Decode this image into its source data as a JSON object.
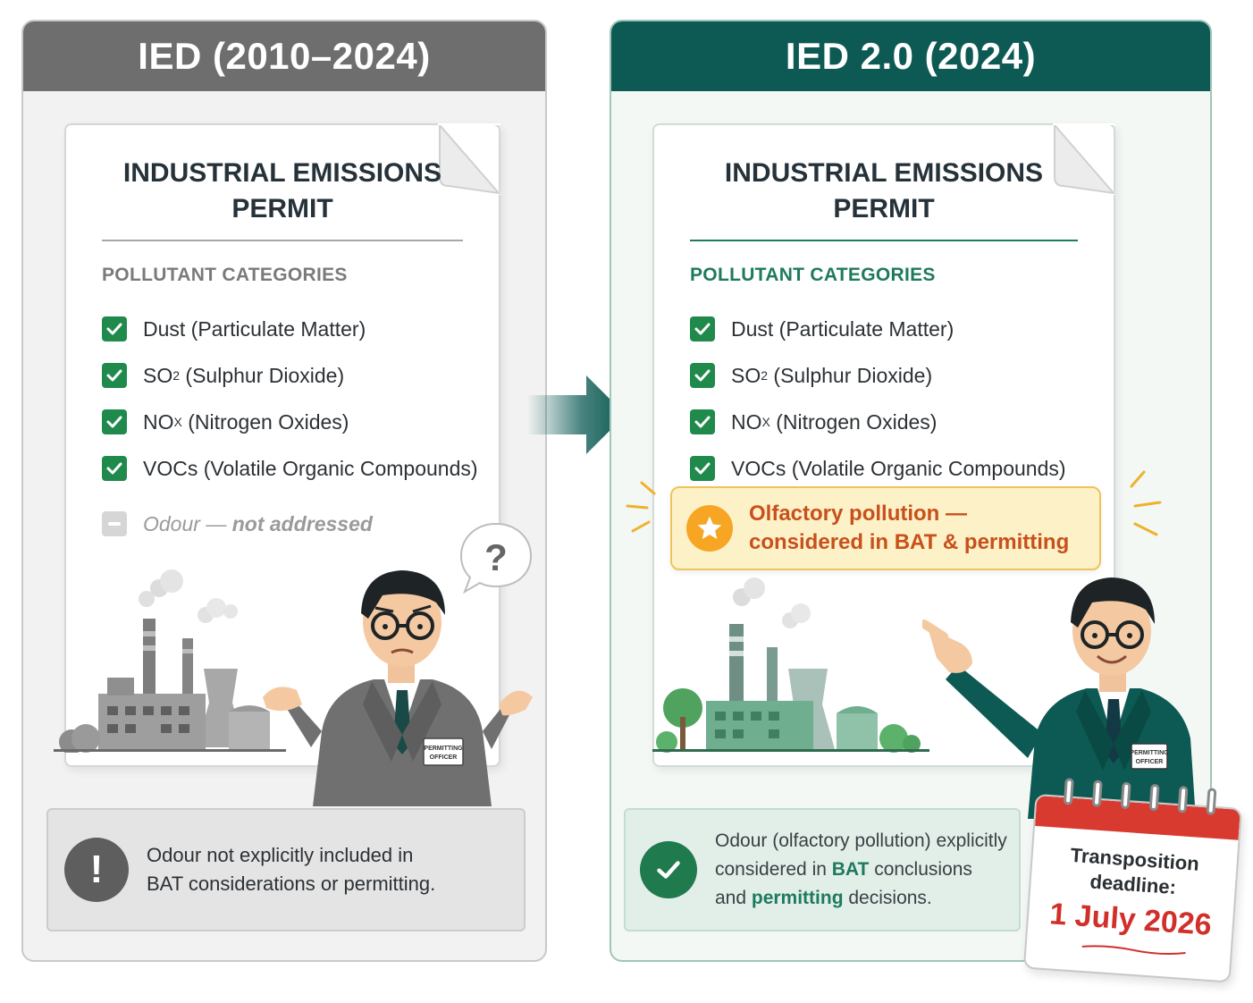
{
  "left_panel": {
    "header": "IED (2010–2024)",
    "permit_title_line1": "INDUSTRIAL EMISSIONS",
    "permit_title_line2": "PERMIT",
    "categories_heading": "POLLUTANT CATEGORIES",
    "categories": [
      {
        "main": "Dust (Particulate Matter)",
        "sub": "",
        "rest": ""
      },
      {
        "main": "SO",
        "sub": "2",
        "rest": " (Sulphur Dioxide)"
      },
      {
        "main": "NO",
        "sub": "X",
        "rest": " (Nitrogen Oxides)"
      },
      {
        "main": "VOCs (Volatile Organic Compounds)",
        "sub": "",
        "rest": ""
      }
    ],
    "odour_item_a": "Odour",
    "odour_item_b": " — ",
    "odour_item_c": "not addressed",
    "speech_bubble": "?",
    "badge_line1": "PERMITTING",
    "badge_line2": "OFFICER",
    "note_icon": "!",
    "note_line1": "Odour not explicitly included in",
    "note_line2": "BAT considerations or permitting."
  },
  "right_panel": {
    "header": "IED 2.0 (2024)",
    "permit_title_line1": "INDUSTRIAL EMISSIONS",
    "permit_title_line2": "PERMIT",
    "categories_heading": "POLLUTANT CATEGORIES",
    "categories": [
      {
        "main": "Dust (Particulate Matter)",
        "sub": "",
        "rest": ""
      },
      {
        "main": "SO",
        "sub": "2",
        "rest": " (Sulphur Dioxide)"
      },
      {
        "main": "NO",
        "sub": "X",
        "rest": " (Nitrogen Oxides)"
      },
      {
        "main": "VOCs (Volatile Organic Compounds)",
        "sub": "",
        "rest": ""
      }
    ],
    "highlight_line1": "Olfactory pollution —",
    "highlight_line2": "considered in BAT & permitting",
    "badge_line1": "PERMITTING",
    "badge_line2": "OFFICER",
    "note_p1": "Odour (olfactory pollution) explicitly",
    "note_p2": "considered in ",
    "note_bat": "BAT",
    "note_p3": " conclusions",
    "note_p4": "and ",
    "note_permitting": "permitting",
    "note_p5": " decisions."
  },
  "calendar": {
    "label_line1": "Transposition",
    "label_line2": "deadline:",
    "date": "1 July 2026"
  },
  "colors": {
    "left_header": "#6e6e6e",
    "right_header": "#0d5a54",
    "check_green": "#1f8a4c",
    "highlight_text": "#c8501b",
    "deadline_red": "#d0302a"
  },
  "icons": [
    "check-icon",
    "exclamation-icon",
    "star-icon",
    "check-circle-icon",
    "transition-arrow-icon",
    "calendar-icon",
    "question-bubble-icon"
  ]
}
